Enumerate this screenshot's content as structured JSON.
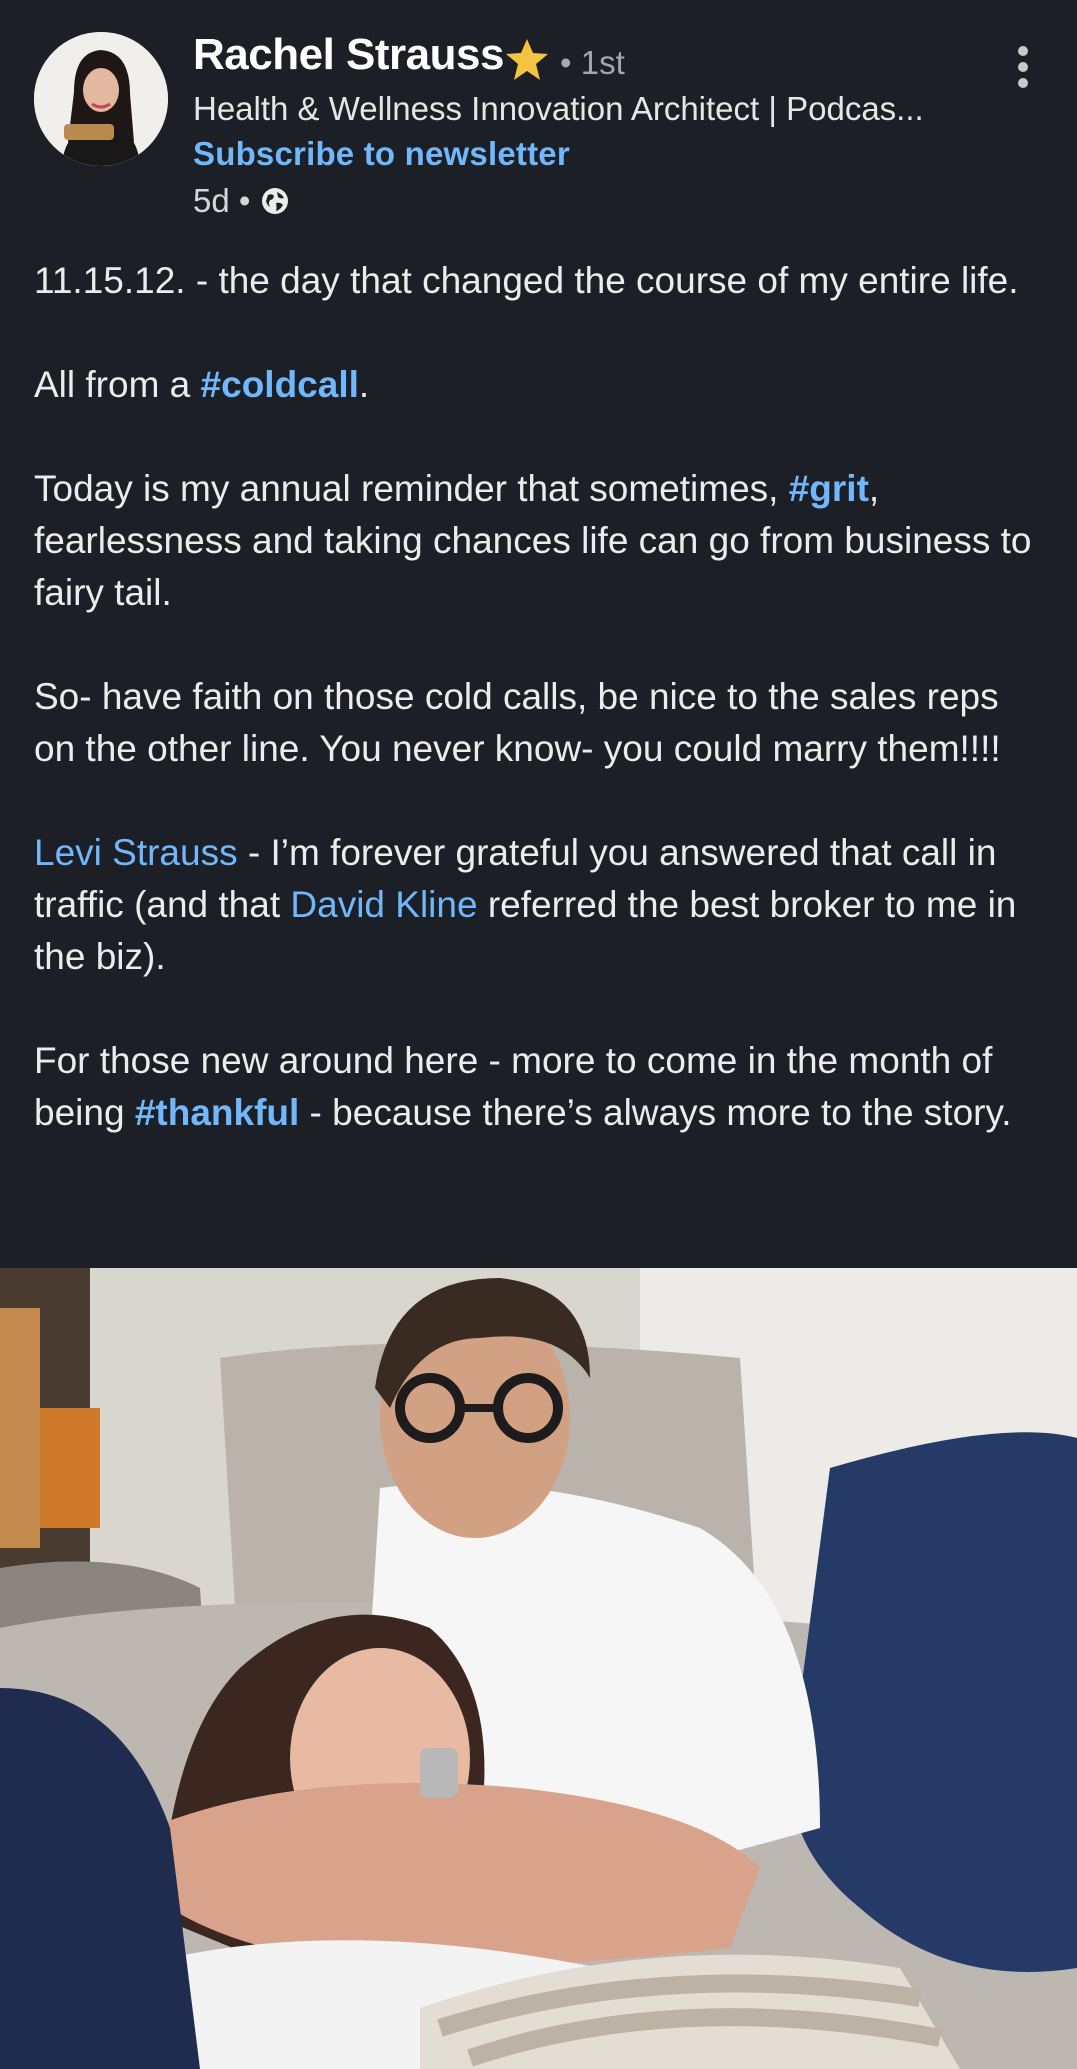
{
  "author": {
    "name": "Rachel Strauss",
    "badge_icon": "star-icon",
    "connection_degree": "• 1st",
    "headline": "Health & Wellness Innovation Architect | Podcas...",
    "subscribe_label": "Subscribe to newsletter",
    "post_age": "5d •",
    "visibility_icon": "globe-icon"
  },
  "menu": {
    "more_icon": "more-vertical-icon"
  },
  "post": {
    "p1": "11.15.12. - the day that changed the course of my entire life.",
    "p2_before": "All from a ",
    "p2_tag": "#coldcall",
    "p2_after": ".",
    "p3_before": "Today is my annual reminder that sometimes, ",
    "p3_tag": "#grit",
    "p3_after": ", fearlessness and taking chances life can go from business to fairy tail.",
    "p4": "So- have faith on those cold calls, be nice to the sales reps on the other line. You never know- you could marry them!!!!",
    "p5_mention1": "Levi Strauss",
    "p5_mid": " - I’m forever grateful you answered that call in traffic (and that ",
    "p5_mention2": "David Kline",
    "p5_after": " referred the best broker to me in the biz).",
    "p6_before": "For those new around here - more to come in the month of being ",
    "p6_tag": "#thankful",
    "p6_after": " - because there’s always more to the story."
  },
  "colors": {
    "background": "#1c2026",
    "link": "#71b7fb",
    "star": "#f5c342"
  }
}
